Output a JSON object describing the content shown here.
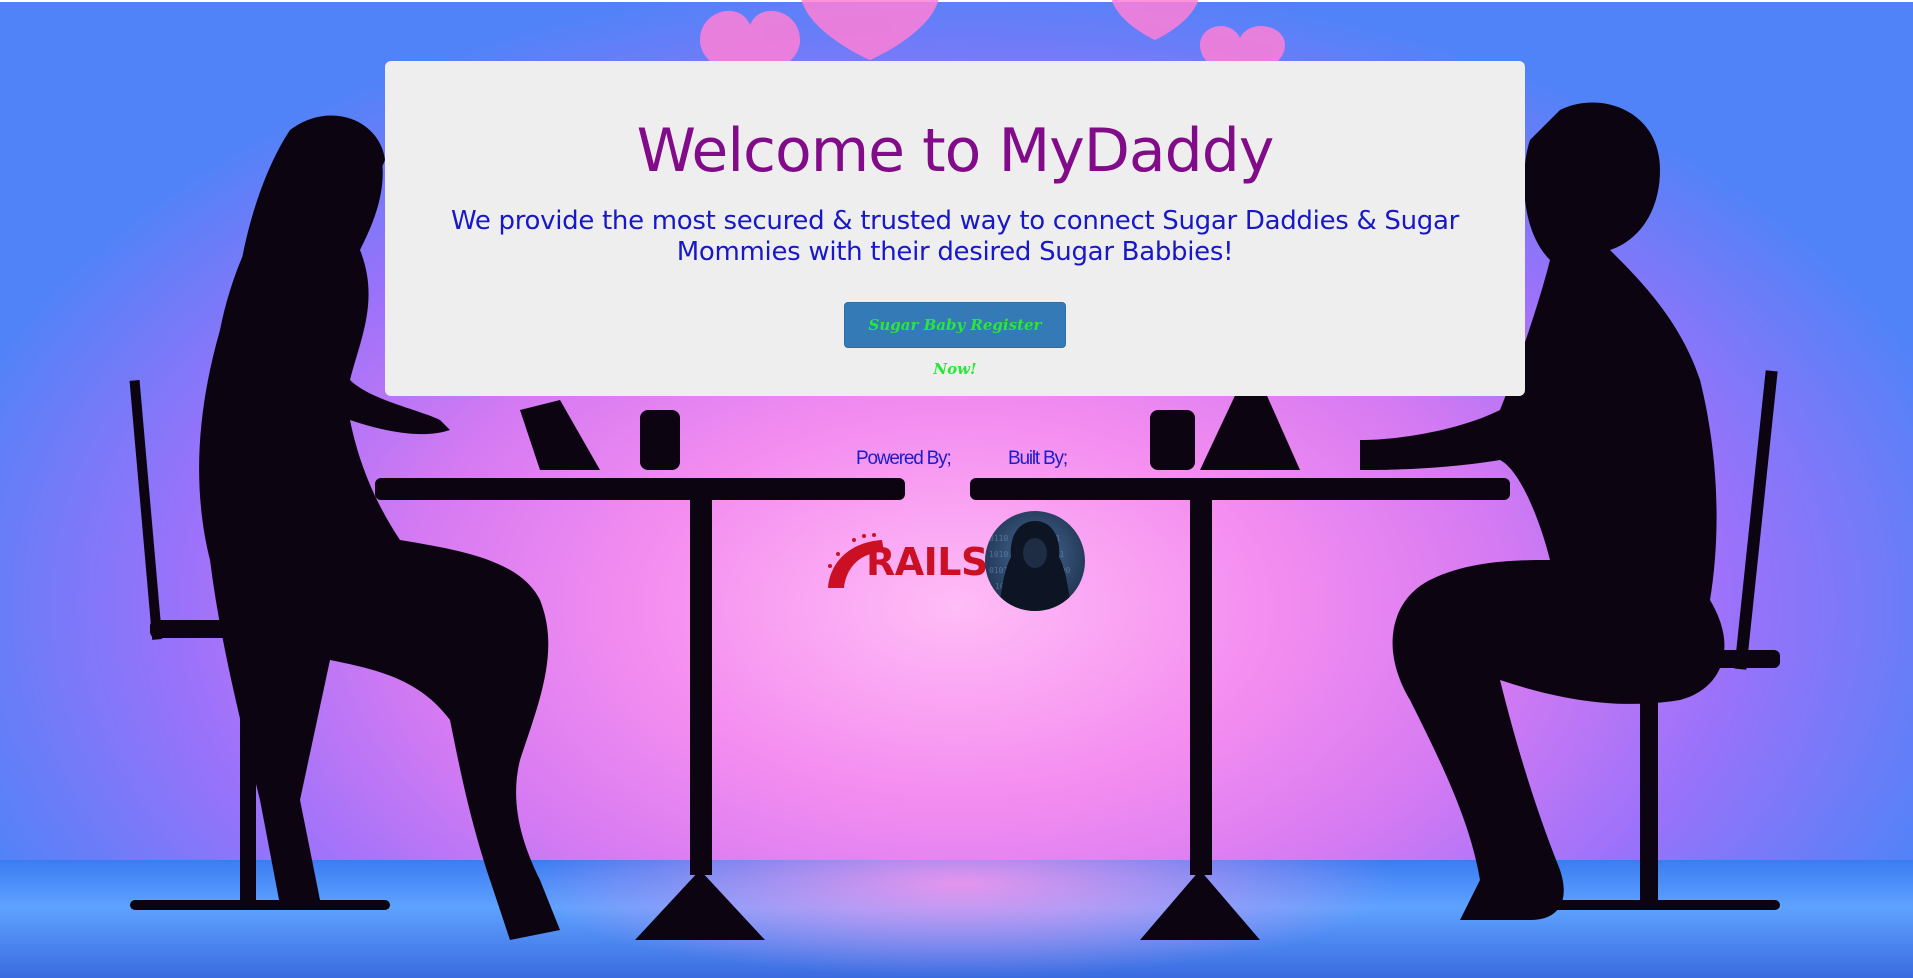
{
  "hero": {
    "title": "Welcome to MyDaddy",
    "tagline": "We provide the most secured & trusted way to connect Sugar Daddies & Sugar Mommies with their desired Sugar Babbies!",
    "register_label": "Sugar Baby Register Now!"
  },
  "credits": {
    "powered_label": "Powered By;",
    "built_label": "Built By;",
    "rails_logo_text": "RAILS"
  },
  "icons": {
    "rails": "rails-logo",
    "builder": "hooded-hacker-avatar"
  },
  "colors": {
    "title": "#820b8a",
    "tagline": "#1818c8",
    "button_bg": "#337ab7",
    "button_text": "#29e63a",
    "panel_bg": "#eeeeee",
    "rails_red": "#cc1024"
  }
}
